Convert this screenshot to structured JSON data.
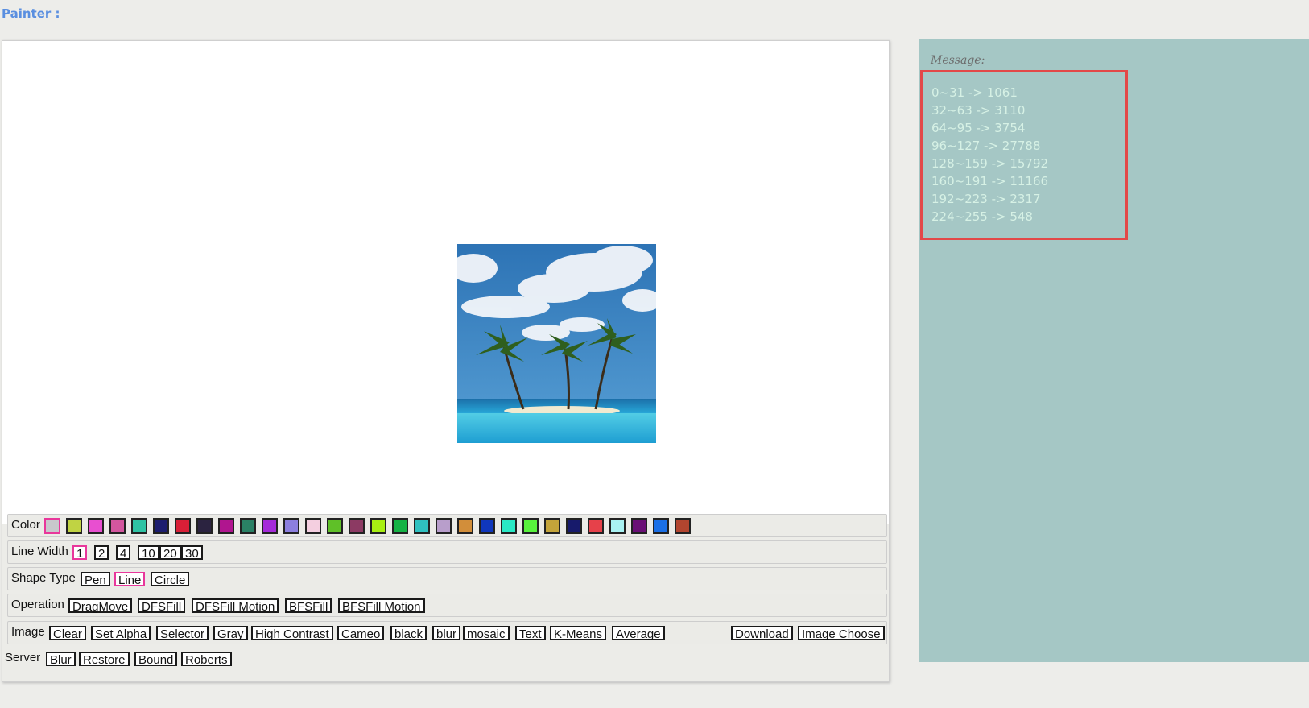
{
  "app_title": "Painter :",
  "toolbar": {
    "color_label": "Color",
    "colors": [
      "#c8c8cc",
      "#c0d343",
      "#e84fd0",
      "#d3569e",
      "#2ec3a4",
      "#1c1d6f",
      "#d81f37",
      "#2b2340",
      "#b0158f",
      "#2a8165",
      "#a42ad9",
      "#8c7fde",
      "#f4cfe0",
      "#5fc028",
      "#8c3a63",
      "#a8ef12",
      "#15b345",
      "#2fc1c0",
      "#b89ecb",
      "#d28e3a",
      "#1037bc",
      "#2ae9c5",
      "#58f23c",
      "#c4a43a",
      "#171a6b",
      "#e6414a",
      "#a9f2f2",
      "#6a0f76",
      "#1a6fe6",
      "#b2452f"
    ],
    "active_color_index": 0,
    "line_width_label": "Line Width",
    "line_widths": [
      "1",
      "2",
      "4",
      "10",
      "20",
      "30"
    ],
    "active_line_width": "1",
    "shape_type_label": "Shape Type",
    "shapes": [
      "Pen",
      "Line",
      "Circle"
    ],
    "active_shape": "Line",
    "operation_label": "Operation",
    "operations": [
      "DragMove",
      "DFSFill",
      "DFSFill Motion",
      "BFSFill",
      "BFSFill Motion"
    ],
    "image_label": "Image",
    "image_ops": [
      "Clear",
      "Set Alpha",
      "Selector",
      "Gray",
      "High Contrast",
      "Cameo",
      "black",
      "blur",
      "mosaic",
      "Text",
      "K-Means",
      "Average"
    ],
    "image_right_ops": [
      "Download",
      "Image Choose"
    ],
    "server_label": "Server",
    "server_ops": [
      "Blur",
      "Restore",
      "Bound",
      "Roberts"
    ]
  },
  "message_panel": {
    "label": "Message:",
    "lines": [
      "0~31 -> 1061",
      "32~63 -> 3110",
      "64~95 -> 3754",
      "96~127 -> 27788",
      "128~159 -> 15792",
      "160~191 -> 11166",
      "192~223 -> 2317",
      "224~255 -> 548"
    ]
  },
  "colors": {
    "accent_active": "#e8379b",
    "message_bg": "#a5c7c5",
    "message_text": "#d6f1e5",
    "message_border": "#e34848",
    "title_color": "#5a8fe0"
  },
  "image_description_icons": [
    "palm-tree-icon",
    "cloud-icon"
  ]
}
